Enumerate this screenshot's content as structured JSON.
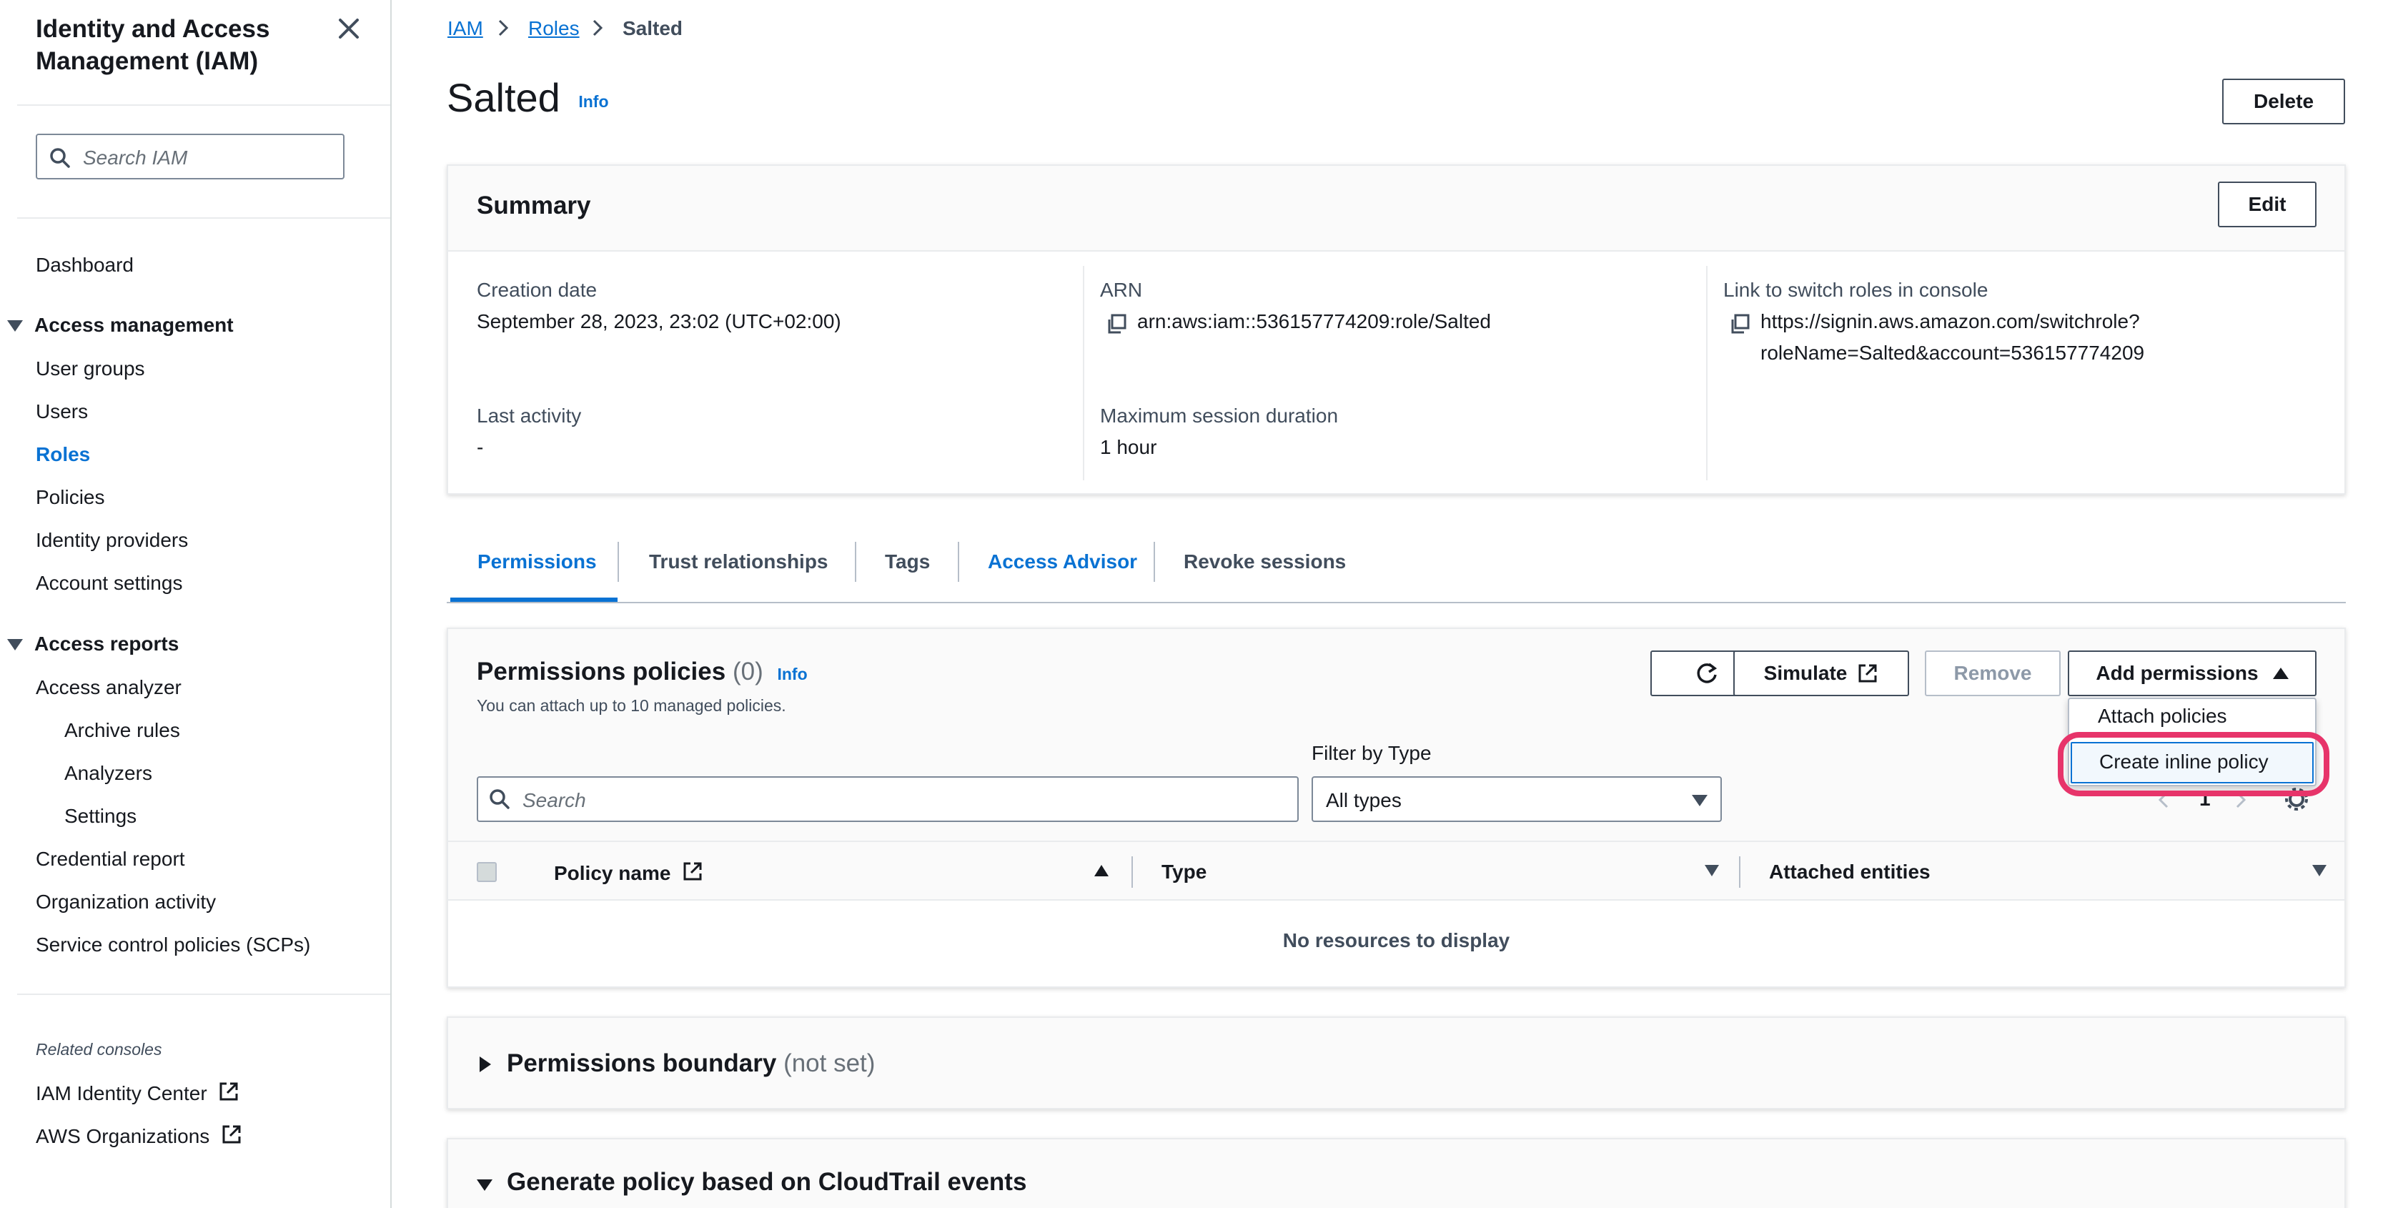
{
  "sidebar": {
    "title": "Identity and Access Management (IAM)",
    "search_placeholder": "Search IAM",
    "dashboard": "Dashboard",
    "access_management": "Access management",
    "am_items": [
      "User groups",
      "Users",
      "Roles",
      "Policies",
      "Identity providers",
      "Account settings"
    ],
    "access_reports": "Access reports",
    "ar_items": [
      "Access analyzer",
      "Archive rules",
      "Analyzers",
      "Settings",
      "Credential report",
      "Organization activity",
      "Service control policies (SCPs)"
    ],
    "related_consoles": "Related consoles",
    "consoles": [
      "IAM Identity Center",
      "AWS Organizations"
    ]
  },
  "breadcrumb": {
    "iam": "IAM",
    "roles": "Roles",
    "current": "Salted"
  },
  "header": {
    "title": "Salted",
    "info": "Info",
    "delete": "Delete"
  },
  "summary": {
    "title": "Summary",
    "edit": "Edit",
    "creation_date_label": "Creation date",
    "creation_date": "September 28, 2023, 23:02 (UTC+02:00)",
    "arn_label": "ARN",
    "arn": "arn:aws:iam::536157774209:role/Salted",
    "switch_label": "Link to switch roles in console",
    "switch_line1": "https://signin.aws.amazon.com/switchrole?",
    "switch_line2": "roleName=Salted&account=536157774209",
    "last_activity_label": "Last activity",
    "last_activity": "-",
    "max_session_label": "Maximum session duration",
    "max_session": "1 hour"
  },
  "tabs": [
    "Permissions",
    "Trust relationships",
    "Tags",
    "Access Advisor",
    "Revoke sessions"
  ],
  "permissions": {
    "title": "Permissions policies",
    "count": "(0)",
    "info": "Info",
    "subtitle": "You can attach up to 10 managed policies.",
    "simulate": "Simulate",
    "remove": "Remove",
    "add_permissions": "Add permissions",
    "filter_label": "Filter by Type",
    "search_placeholder": "Search",
    "filter_value": "All types",
    "col_policy": "Policy name",
    "col_type": "Type",
    "col_attached": "Attached entities",
    "empty": "No resources to display",
    "page": "1",
    "menu": [
      "Attach policies",
      "Create inline policy"
    ]
  },
  "boundary": {
    "title": "Permissions boundary",
    "status": "(not set)"
  },
  "generate": {
    "title": "Generate policy based on CloudTrail events"
  }
}
